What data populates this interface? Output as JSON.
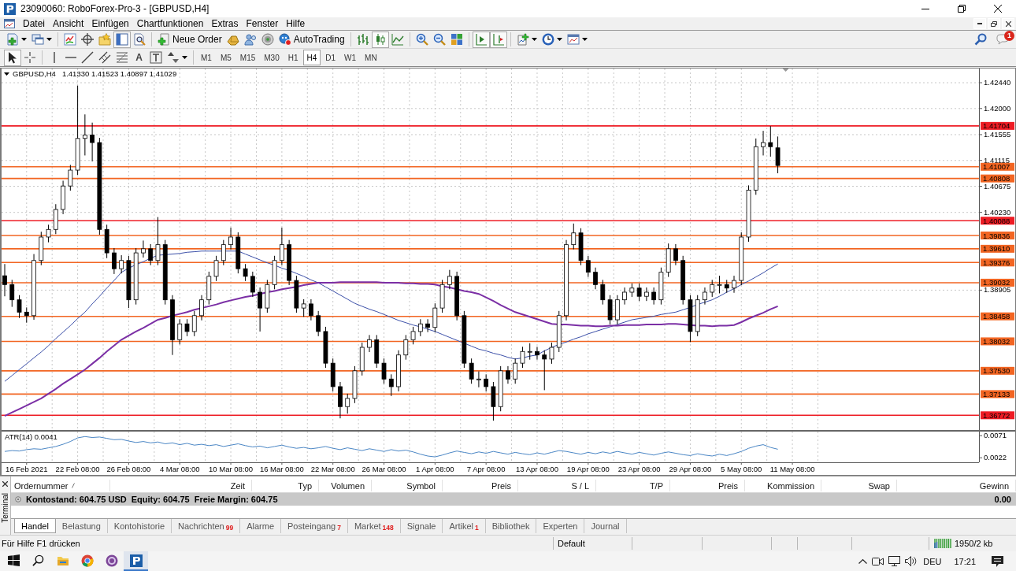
{
  "window": {
    "title": "23090060: RoboForex-Pro-3 - [GBPUSD,H4]"
  },
  "menu": [
    "Datei",
    "Ansicht",
    "Einfügen",
    "Chartfunktionen",
    "Extras",
    "Fenster",
    "Hilfe"
  ],
  "toolbar": [
    {
      "kind": "menu_button",
      "pressed": false
    },
    {
      "kind": "menu_button",
      "pressed": false
    },
    {
      "kind": "separator"
    },
    {
      "kind": "button",
      "pressed": false
    },
    {
      "kind": "button",
      "pressed": false
    },
    {
      "kind": "button",
      "pressed": false
    },
    {
      "kind": "button",
      "pressed": true
    },
    {
      "kind": "button",
      "pressed": false
    },
    {
      "kind": "separator"
    },
    {
      "kind": "button",
      "pressed": false,
      "label": "Neue Order"
    },
    {
      "kind": "button",
      "pressed": false
    },
    {
      "kind": "button",
      "pressed": false
    },
    {
      "kind": "button",
      "pressed": false
    },
    {
      "kind": "button",
      "pressed": false,
      "label": "AutoTrading"
    },
    {
      "kind": "separator"
    },
    {
      "kind": "button",
      "pressed": false
    },
    {
      "kind": "button",
      "pressed": true
    },
    {
      "kind": "button",
      "pressed": false
    },
    {
      "kind": "separator"
    },
    {
      "kind": "button",
      "pressed": false
    },
    {
      "kind": "button",
      "pressed": false
    },
    {
      "kind": "button",
      "pressed": false
    },
    {
      "kind": "separator"
    },
    {
      "kind": "button",
      "pressed": true
    },
    {
      "kind": "button",
      "pressed": true
    },
    {
      "kind": "separator"
    },
    {
      "kind": "menu_button",
      "pressed": false
    },
    {
      "kind": "menu_button",
      "pressed": false
    },
    {
      "kind": "menu_button",
      "pressed": false
    }
  ],
  "notifications": {
    "badge": "1"
  },
  "drawing_toolbar": [
    {
      "kind": "button",
      "pressed": true
    },
    {
      "kind": "button",
      "pressed": false
    },
    {
      "kind": "separator"
    },
    {
      "kind": "button",
      "pressed": false
    },
    {
      "kind": "button",
      "pressed": false
    },
    {
      "kind": "button",
      "pressed": false
    },
    {
      "kind": "button",
      "pressed": false
    },
    {
      "kind": "button",
      "pressed": false
    },
    {
      "kind": "button",
      "pressed": false,
      "label": "A"
    },
    {
      "kind": "button",
      "pressed": false
    },
    {
      "kind": "menu_button",
      "pressed": false
    }
  ],
  "timeframes": [
    {
      "label": "M1",
      "selected": false
    },
    {
      "label": "M5",
      "selected": false
    },
    {
      "label": "M15",
      "selected": false
    },
    {
      "label": "M30",
      "selected": false
    },
    {
      "label": "H1",
      "selected": false
    },
    {
      "label": "H4",
      "selected": true
    },
    {
      "label": "D1",
      "selected": false
    },
    {
      "label": "W1",
      "selected": false
    },
    {
      "label": "MN",
      "selected": false
    }
  ],
  "chart": {
    "chart_data": [
      {
        "type": "candlestick",
        "title": "GBPUSD,H4",
        "subtitle": "1.41330 1.41523 1.40897 1.41029",
        "ylim": [
          1.36521,
          1.42682
        ],
        "yticks": [
          {
            "value": 1.4244,
            "label": "1.42440"
          },
          {
            "value": 1.42,
            "label": "1.42000"
          },
          {
            "value": 1.41555,
            "label": "1.41555"
          },
          {
            "value": 1.41115,
            "label": "1.41115"
          },
          {
            "value": 1.40675,
            "label": "1.40675"
          },
          {
            "value": 1.4023,
            "label": "1.40230"
          },
          {
            "value": 1.38905,
            "label": "1.38905"
          }
        ],
        "tick_labels": "y",
        "grid": true,
        "ohlc": [
          [
            1.3915,
            1.3935,
            1.388,
            1.39
          ],
          [
            1.39,
            1.3908,
            1.3862,
            1.3874
          ],
          [
            1.3874,
            1.3882,
            1.3843,
            1.3853
          ],
          [
            1.3853,
            1.3861,
            1.3835,
            1.3847
          ],
          [
            1.3847,
            1.3952,
            1.384,
            1.3941
          ],
          [
            1.3941,
            1.399,
            1.3933,
            1.3981
          ],
          [
            1.3981,
            1.4002,
            1.3972,
            1.3994
          ],
          [
            1.3994,
            1.4037,
            1.3986,
            1.4028
          ],
          [
            1.4028,
            1.4077,
            1.402,
            1.4068
          ],
          [
            1.4068,
            1.4104,
            1.406,
            1.4095
          ],
          [
            1.4095,
            1.4239,
            1.4087,
            1.4149
          ],
          [
            1.4149,
            1.419,
            1.412,
            1.4155
          ],
          [
            1.4155,
            1.4176,
            1.411,
            1.4142
          ],
          [
            1.4142,
            1.415,
            1.3985,
            1.3994
          ],
          [
            1.3994,
            1.4002,
            1.3945,
            1.3954
          ],
          [
            1.3954,
            1.3962,
            1.3918,
            1.3927
          ],
          [
            1.3927,
            1.395,
            1.3919,
            1.3941
          ],
          [
            1.3941,
            1.3949,
            1.386,
            1.3874
          ],
          [
            1.3874,
            1.3962,
            1.3866,
            1.3954
          ],
          [
            1.3954,
            1.3975,
            1.3946,
            1.3961
          ],
          [
            1.3961,
            1.3969,
            1.3933,
            1.3941
          ],
          [
            1.3941,
            1.4015,
            1.3933,
            1.3968
          ],
          [
            1.3968,
            1.3976,
            1.3866,
            1.3874
          ],
          [
            1.3874,
            1.3882,
            1.378,
            1.3806
          ],
          [
            1.3806,
            1.3841,
            1.3798,
            1.3833
          ],
          [
            1.3833,
            1.3841,
            1.3812,
            1.382
          ],
          [
            1.382,
            1.3855,
            1.3812,
            1.3847
          ],
          [
            1.3847,
            1.3882,
            1.3839,
            1.3874
          ],
          [
            1.3874,
            1.3922,
            1.3866,
            1.3914
          ],
          [
            1.3914,
            1.3949,
            1.3906,
            1.3941
          ],
          [
            1.3941,
            1.3976,
            1.3933,
            1.3968
          ],
          [
            1.3968,
            1.3997,
            1.396,
            1.3981
          ],
          [
            1.3981,
            1.3989,
            1.3919,
            1.3927
          ],
          [
            1.3927,
            1.3935,
            1.3906,
            1.3914
          ],
          [
            1.3914,
            1.3922,
            1.3879,
            1.3887
          ],
          [
            1.3887,
            1.3895,
            1.382,
            1.386
          ],
          [
            1.386,
            1.3908,
            1.3852,
            1.39
          ],
          [
            1.39,
            1.3949,
            1.3892,
            1.3941
          ],
          [
            1.3941,
            1.3997,
            1.3933,
            1.3968
          ],
          [
            1.3968,
            1.3976,
            1.3899,
            1.3907
          ],
          [
            1.3907,
            1.3915,
            1.3852,
            1.386
          ],
          [
            1.386,
            1.3875,
            1.3845,
            1.3867
          ],
          [
            1.3867,
            1.3875,
            1.3839,
            1.3847
          ],
          [
            1.3847,
            1.3855,
            1.3812,
            1.382
          ],
          [
            1.382,
            1.3828,
            1.3758,
            1.3766
          ],
          [
            1.3766,
            1.3774,
            1.3718,
            1.3726
          ],
          [
            1.3726,
            1.3734,
            1.3672,
            1.3692
          ],
          [
            1.3692,
            1.3714,
            1.368,
            1.3706
          ],
          [
            1.3706,
            1.3761,
            1.3698,
            1.3753
          ],
          [
            1.3753,
            1.3801,
            1.3745,
            1.3793
          ],
          [
            1.3793,
            1.3814,
            1.3785,
            1.3806
          ],
          [
            1.3806,
            1.3814,
            1.3758,
            1.3766
          ],
          [
            1.3766,
            1.3774,
            1.3731,
            1.3739
          ],
          [
            1.3739,
            1.3747,
            1.371,
            1.3726
          ],
          [
            1.3726,
            1.3788,
            1.3718,
            1.378
          ],
          [
            1.378,
            1.3814,
            1.3772,
            1.3806
          ],
          [
            1.3806,
            1.3828,
            1.3798,
            1.382
          ],
          [
            1.382,
            1.3841,
            1.3812,
            1.3833
          ],
          [
            1.3833,
            1.3841,
            1.3819,
            1.3827
          ],
          [
            1.3827,
            1.3868,
            1.3819,
            1.386
          ],
          [
            1.386,
            1.3908,
            1.3852,
            1.39
          ],
          [
            1.39,
            1.3925,
            1.3892,
            1.3914
          ],
          [
            1.3914,
            1.3922,
            1.3839,
            1.3847
          ],
          [
            1.3847,
            1.3855,
            1.3758,
            1.3766
          ],
          [
            1.3766,
            1.3774,
            1.3731,
            1.3739
          ],
          [
            1.3739,
            1.3752,
            1.3725,
            1.3739
          ],
          [
            1.3739,
            1.3747,
            1.3718,
            1.3726
          ],
          [
            1.3726,
            1.3734,
            1.3668,
            1.3692
          ],
          [
            1.3692,
            1.3761,
            1.3684,
            1.3753
          ],
          [
            1.3753,
            1.3761,
            1.3731,
            1.3739
          ],
          [
            1.3739,
            1.3774,
            1.3731,
            1.3766
          ],
          [
            1.3766,
            1.3794,
            1.3758,
            1.3786
          ],
          [
            1.3786,
            1.38,
            1.3772,
            1.3786
          ],
          [
            1.3786,
            1.3794,
            1.3772,
            1.378
          ],
          [
            1.378,
            1.3788,
            1.372,
            1.3773
          ],
          [
            1.3773,
            1.3801,
            1.3765,
            1.3793
          ],
          [
            1.3793,
            1.3855,
            1.3785,
            1.3847
          ],
          [
            1.3847,
            1.3976,
            1.3839,
            1.3968
          ],
          [
            1.3968,
            1.4004,
            1.396,
            1.3988
          ],
          [
            1.3988,
            1.3996,
            1.3933,
            1.3941
          ],
          [
            1.3941,
            1.3949,
            1.3913,
            1.3921
          ],
          [
            1.3921,
            1.3929,
            1.3892,
            1.39
          ],
          [
            1.39,
            1.3908,
            1.3866,
            1.3874
          ],
          [
            1.3874,
            1.3882,
            1.3832,
            1.384
          ],
          [
            1.384,
            1.3882,
            1.3832,
            1.3874
          ],
          [
            1.3874,
            1.3895,
            1.3866,
            1.3887
          ],
          [
            1.3887,
            1.3902,
            1.3879,
            1.3894
          ],
          [
            1.3894,
            1.3902,
            1.3872,
            1.388
          ],
          [
            1.388,
            1.3895,
            1.3872,
            1.3887
          ],
          [
            1.3887,
            1.3895,
            1.3866,
            1.3874
          ],
          [
            1.3874,
            1.3929,
            1.3866,
            1.3921
          ],
          [
            1.3921,
            1.397,
            1.3913,
            1.3961
          ],
          [
            1.3961,
            1.3969,
            1.3933,
            1.3941
          ],
          [
            1.3941,
            1.3949,
            1.3866,
            1.3874
          ],
          [
            1.3874,
            1.3882,
            1.3802,
            1.382
          ],
          [
            1.382,
            1.3882,
            1.3812,
            1.3874
          ],
          [
            1.3874,
            1.3895,
            1.3866,
            1.3887
          ],
          [
            1.3887,
            1.3908,
            1.3879,
            1.39
          ],
          [
            1.39,
            1.3915,
            1.3885,
            1.39
          ],
          [
            1.39,
            1.3908,
            1.3886,
            1.3894
          ],
          [
            1.3894,
            1.3915,
            1.3886,
            1.3907
          ],
          [
            1.3907,
            1.3989,
            1.3899,
            1.3981
          ],
          [
            1.3981,
            1.4069,
            1.3973,
            1.4061
          ],
          [
            1.4061,
            1.4149,
            1.4053,
            1.4135
          ],
          [
            1.4135,
            1.4162,
            1.412,
            1.4142
          ],
          [
            1.4142,
            1.417,
            1.4118,
            1.4135
          ],
          [
            1.4133,
            1.41523,
            1.40897,
            1.41029
          ]
        ],
        "series": [
          {
            "type": "line",
            "color": "#3b4fa8",
            "values": [
              1.3735,
              1.3745,
              1.3755,
              1.3765,
              1.3775,
              1.3785,
              1.3796,
              1.3808,
              1.3819,
              1.383,
              1.3842,
              1.3853,
              1.3867,
              1.388,
              1.3894,
              1.3907,
              1.3921,
              1.3928,
              1.3934,
              1.3939,
              1.3945,
              1.395,
              1.3951,
              1.3952,
              1.3953,
              1.3955,
              1.3956,
              1.3957,
              1.3957,
              1.3957,
              1.3957,
              1.3957,
              1.3957,
              1.3952,
              1.3947,
              1.3942,
              1.3937,
              1.3933,
              1.3928,
              1.3924,
              1.3919,
              1.3914,
              1.3908,
              1.3903,
              1.3896,
              1.3889,
              1.3882,
              1.3875,
              1.3868,
              1.3863,
              1.3858,
              1.3854,
              1.3849,
              1.3844,
              1.3839,
              1.3835,
              1.3831,
              1.3828,
              1.3824,
              1.382,
              1.3815,
              1.381,
              1.3805,
              1.38,
              1.3795,
              1.379,
              1.3787,
              1.3783,
              1.378,
              1.3776,
              1.3773,
              1.3775,
              1.3778,
              1.378,
              1.3787,
              1.3793,
              1.3798,
              1.3802,
              1.3807,
              1.3811,
              1.3816,
              1.382,
              1.3824,
              1.3828,
              1.3832,
              1.3836,
              1.384,
              1.3842,
              1.3844,
              1.3846,
              1.3849,
              1.3851,
              1.3853,
              1.3857,
              1.3861,
              1.3866,
              1.387,
              1.3874,
              1.388,
              1.3887,
              1.3893,
              1.39,
              1.3906,
              1.3913,
              1.392,
              1.3928,
              1.3935
            ]
          },
          {
            "type": "line",
            "color": "#7b2fa5",
            "values": [
              1.3676,
              1.3682,
              1.3688,
              1.3694,
              1.37,
              1.3706,
              1.3714,
              1.3722,
              1.3731,
              1.3739,
              1.3747,
              1.3755,
              1.3765,
              1.3775,
              1.3786,
              1.3796,
              1.3806,
              1.3813,
              1.382,
              1.3826,
              1.3833,
              1.384,
              1.3843,
              1.3847,
              1.385,
              1.3853,
              1.3857,
              1.386,
              1.3863,
              1.3866,
              1.387,
              1.3873,
              1.3876,
              1.3879,
              1.3881,
              1.3884,
              1.3887,
              1.3889,
              1.3892,
              1.3894,
              1.3896,
              1.3899,
              1.3901,
              1.3903,
              1.3903,
              1.3903,
              1.3904,
              1.3904,
              1.3904,
              1.3904,
              1.3904,
              1.3904,
              1.3903,
              1.3903,
              1.3903,
              1.3902,
              1.3902,
              1.3901,
              1.3901,
              1.39,
              1.3897,
              1.3895,
              1.3892,
              1.3889,
              1.3887,
              1.3884,
              1.3878,
              1.3872,
              1.3865,
              1.3859,
              1.3853,
              1.3849,
              1.3845,
              1.3841,
              1.3837,
              1.3833,
              1.3832,
              1.3832,
              1.3831,
              1.383,
              1.383,
              1.3829,
              1.3829,
              1.383,
              1.383,
              1.3831,
              1.3831,
              1.3831,
              1.3832,
              1.3832,
              1.3832,
              1.3833,
              1.3833,
              1.3832,
              1.3831,
              1.383,
              1.383,
              1.3829,
              1.383,
              1.383,
              1.3831,
              1.3836,
              1.3842,
              1.3847,
              1.3852,
              1.3858,
              1.3863
            ]
          }
        ],
        "ref_lines": [
          {
            "axis": "y",
            "value": 1.41704,
            "label": "1.41704",
            "color": "#ee1c24"
          },
          {
            "axis": "y",
            "value": 1.41007,
            "label": "1.41007",
            "color": "#f26522"
          },
          {
            "axis": "y",
            "value": 1.40808,
            "label": "1.40808",
            "color": "#f26522"
          },
          {
            "axis": "y",
            "value": 1.40088,
            "label": "1.40088",
            "color": "#ee1c24"
          },
          {
            "axis": "y",
            "value": 1.39836,
            "label": "1.39836",
            "color": "#f26522"
          },
          {
            "axis": "y",
            "value": 1.3961,
            "label": "1.39610",
            "color": "#f26522"
          },
          {
            "axis": "y",
            "value": 1.39376,
            "label": "1.39376",
            "color": "#f26522"
          },
          {
            "axis": "y",
            "value": 1.39032,
            "label": "1.39032",
            "color": "#f26522"
          },
          {
            "axis": "y",
            "value": 1.38458,
            "label": "1.38458",
            "color": "#f26522"
          },
          {
            "axis": "y",
            "value": 1.38032,
            "label": "1.38032",
            "color": "#f26522"
          },
          {
            "axis": "y",
            "value": 1.3753,
            "label": "1.37530",
            "color": "#f26522"
          },
          {
            "axis": "y",
            "value": 1.37133,
            "label": "1.37133",
            "color": "#f26522"
          },
          {
            "axis": "y",
            "value": 1.36772,
            "label": "1.36772",
            "color": "#ee1c24"
          }
        ]
      },
      {
        "type": "line",
        "title": "ATR(14) 0.0041",
        "color": "#4a86c5",
        "ylim": [
          0.0012,
          0.008
        ],
        "yticks": [
          {
            "value": 0.0071,
            "label": "0.0071"
          },
          {
            "value": 0.0022,
            "label": "0.0022"
          }
        ],
        "grid": true,
        "categories": [
          null,
          null,
          null,
          "16 Feb 2021",
          null,
          null,
          null,
          null,
          null,
          null,
          "22 Feb 08:00",
          null,
          null,
          null,
          null,
          null,
          null,
          "26 Feb 08:00",
          null,
          null,
          null,
          null,
          null,
          null,
          "4 Mar 08:00",
          null,
          null,
          null,
          null,
          null,
          null,
          "10 Mar 08:00",
          null,
          null,
          null,
          null,
          null,
          null,
          "16 Mar 08:00",
          null,
          null,
          null,
          null,
          null,
          null,
          "22 Mar 08:00",
          null,
          null,
          null,
          null,
          null,
          null,
          "26 Mar 08:00",
          null,
          null,
          null,
          null,
          null,
          null,
          "1 Apr 08:00",
          null,
          null,
          null,
          null,
          null,
          null,
          "7 Apr 08:00",
          null,
          null,
          null,
          null,
          null,
          null,
          "13 Apr 08:00",
          null,
          null,
          null,
          null,
          null,
          null,
          "19 Apr 08:00",
          null,
          null,
          null,
          null,
          null,
          null,
          "23 Apr 08:00",
          null,
          null,
          null,
          null,
          null,
          null,
          "29 Apr 08:00",
          null,
          null,
          null,
          null,
          null,
          null,
          "5 May 08:00",
          null,
          null,
          null,
          null,
          null,
          null,
          "11 May 08:00"
        ],
        "values": [
          0.0036,
          0.0038,
          0.0037,
          0.004,
          0.0042,
          0.0041,
          0.0044,
          0.0047,
          0.0052,
          0.0058,
          0.0066,
          0.0069,
          0.0067,
          0.0068,
          0.0065,
          0.0062,
          0.0063,
          0.0059,
          0.0056,
          0.0058,
          0.0055,
          0.0057,
          0.0053,
          0.0055,
          0.0051,
          0.0054,
          0.005,
          0.0052,
          0.0049,
          0.0051,
          0.0047,
          0.005,
          0.0053,
          0.0049,
          0.0046,
          0.0048,
          0.0044,
          0.0047,
          0.005,
          0.0046,
          0.0043,
          0.0045,
          0.0042,
          0.0044,
          0.0047,
          0.0043,
          0.004,
          0.0044,
          0.0041,
          0.0038,
          0.0042,
          0.0039,
          0.0036,
          0.004,
          0.0037,
          0.0039,
          0.0035,
          0.003,
          0.0026,
          0.0024,
          0.0028,
          0.0033,
          0.0037,
          0.0034,
          0.0031,
          0.0035,
          0.0032,
          0.0036,
          0.0033,
          0.003,
          0.0034,
          0.0031,
          0.0029,
          0.0033,
          0.003,
          0.0034,
          0.0038,
          0.0036,
          0.0033,
          0.003,
          0.0034,
          0.0031,
          0.0035,
          0.0032,
          0.0036,
          0.0033,
          0.003,
          0.0034,
          0.0031,
          0.0028,
          0.0032,
          0.0035,
          0.0032,
          0.0029,
          0.0027,
          0.0031,
          0.0028,
          0.0026,
          0.003,
          0.0027,
          0.0031,
          0.0036,
          0.0043,
          0.0048,
          0.0051,
          0.0045,
          0.0041,
          null,
          null
        ]
      }
    ]
  },
  "terminal": {
    "label": "Terminal",
    "columns": [
      {
        "label": "Ordernummer",
        "sorted": true
      },
      {
        "label": "Zeit",
        "sorted": false
      },
      {
        "label": "Typ",
        "sorted": false
      },
      {
        "label": "Volumen",
        "sorted": false
      },
      {
        "label": "Symbol",
        "sorted": false
      },
      {
        "label": "Preis",
        "sorted": false
      },
      {
        "label": "S / L",
        "sorted": false
      },
      {
        "label": "T/P",
        "sorted": false
      },
      {
        "label": "Preis",
        "sorted": false
      },
      {
        "label": "Kommission",
        "sorted": false
      },
      {
        "label": "Swap",
        "sorted": false
      },
      {
        "label": "Gewinn",
        "sorted": false
      }
    ],
    "summary": [
      "Kontostand: 604.75 USD",
      "Equity: 604.75",
      "Freie Margin: 604.75"
    ],
    "profit": "0.00",
    "tabs": [
      {
        "label": "Handel",
        "selected": true
      },
      {
        "label": "Belastung",
        "selected": false
      },
      {
        "label": "Kontohistorie",
        "selected": false
      },
      {
        "label": "Nachrichten",
        "count": "99",
        "selected": false
      },
      {
        "label": "Alarme",
        "selected": false
      },
      {
        "label": "Posteingang",
        "count": "7",
        "selected": false
      },
      {
        "label": "Market",
        "count": "148",
        "selected": false
      },
      {
        "label": "Signale",
        "selected": false
      },
      {
        "label": "Artikel",
        "count": "1",
        "selected": false
      },
      {
        "label": "Bibliothek",
        "selected": false
      },
      {
        "label": "Experten",
        "selected": false
      },
      {
        "label": "Journal",
        "selected": false
      }
    ]
  },
  "status_bar": {
    "help": "Für Hilfe F1 drücken",
    "profile": "Default",
    "traffic": "1950/2 kb"
  },
  "taskbar": {
    "apps": [
      {
        "selected": false
      },
      {
        "selected": false
      },
      {
        "selected": false
      },
      {
        "selected": true
      }
    ],
    "language": "DEU",
    "time": "17:21"
  }
}
